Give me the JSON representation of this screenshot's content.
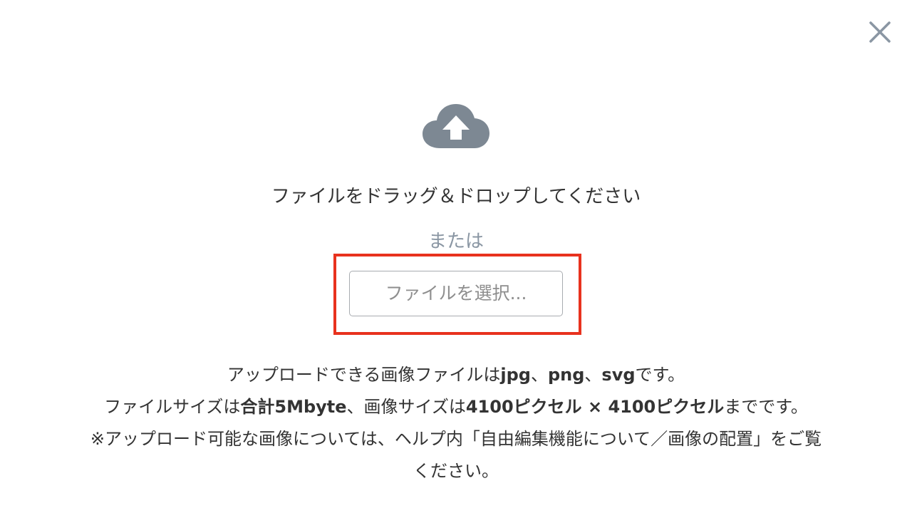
{
  "close": {
    "icon": "close-icon",
    "color": "#8a96a3"
  },
  "upload": {
    "icon": "cloud-upload-icon",
    "icon_color": "#7d8893",
    "drop_text": "ファイルをドラッグ＆ドロップしてください",
    "or_text": "または",
    "select_button_label": "ファイルを選択...",
    "highlight_color": "#e8321e"
  },
  "info": {
    "line1": {
      "p1": "アップロードできる画像ファイルは",
      "b1": "jpg",
      "p2": "、",
      "b2": "png",
      "p3": "、",
      "b3": "svg",
      "p4": "です。"
    },
    "line2": {
      "p1": "ファイルサイズは",
      "b1": "合計5Mbyte",
      "p2": "、画像サイズは",
      "b2": "4100ピクセル × 4100ピクセル",
      "p3": "までです。"
    },
    "line3": "※アップロード可能な画像については、ヘルプ内「自由編集機能について／画像の配置」をご覧",
    "line4": "ください。"
  }
}
